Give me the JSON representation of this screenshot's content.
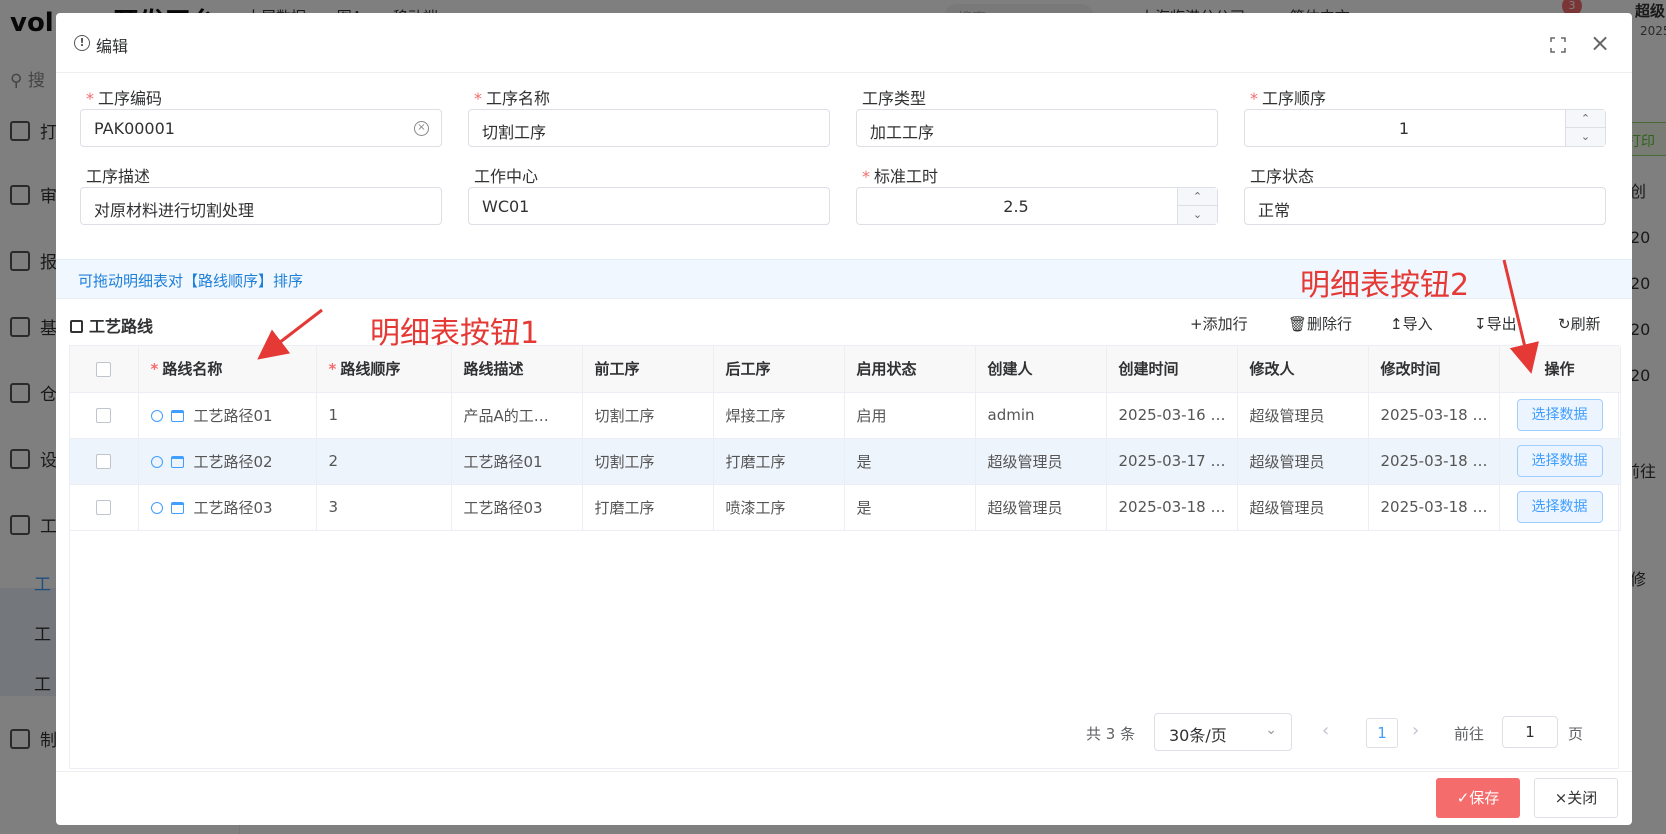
{
  "background": {
    "logo": "vol.pro开发平台",
    "top_nav": [
      "大屏数据",
      "图A",
      "移动端"
    ],
    "search_placeholder": "搜索",
    "company": "上海临港分公司",
    "language": "简体中文",
    "badge_count": "3",
    "user_name": "超级",
    "user_date": "2025",
    "sidebar_search": "搜",
    "sidebar_items": [
      "打",
      "审",
      "报",
      "基",
      "仓",
      "设",
      "工",
      "工",
      "工",
      "工",
      "制"
    ],
    "right_col": [
      "打印",
      "创",
      "20",
      "20",
      "20",
      "20",
      "前往",
      "修"
    ]
  },
  "dialog": {
    "title": "编辑",
    "fields": {
      "code": {
        "label": "工序编码",
        "value": "PAK00001",
        "required": true
      },
      "name": {
        "label": "工序名称",
        "value": "切割工序",
        "required": true
      },
      "type": {
        "label": "工序类型",
        "value": "加工工序",
        "required": false
      },
      "order": {
        "label": "工序顺序",
        "value": "1",
        "required": true
      },
      "desc": {
        "label": "工序描述",
        "value": "对原材料进行切割处理",
        "required": false
      },
      "center": {
        "label": "工作中心",
        "value": "WC01",
        "required": false
      },
      "std_time": {
        "label": "标准工时",
        "value": "2.5",
        "required": true
      },
      "status": {
        "label": "工序状态",
        "value": "正常",
        "required": false
      }
    },
    "tip": "可拖动明细表对【路线顺序】排序",
    "section_title": "工艺路线",
    "toolbar": {
      "add": "添加行",
      "delete": "删除行",
      "import": "导入",
      "export": "导出",
      "refresh": "刷新"
    },
    "table": {
      "columns": [
        "路线名称",
        "路线顺序",
        "路线描述",
        "前工序",
        "后工序",
        "启用状态",
        "创建人",
        "创建时间",
        "修改人",
        "修改时间",
        "操作"
      ],
      "required_columns": [
        "路线名称",
        "路线顺序"
      ],
      "rows": [
        {
          "name": "工艺路径01",
          "order": "1",
          "desc": "产品A的工…",
          "prev": "切割工序",
          "next": "焊接工序",
          "enabled": "启用",
          "creator": "admin",
          "created": "2025-03-16 …",
          "modifier": "超级管理员",
          "modified": "2025-03-18 …",
          "action": "选择数据"
        },
        {
          "name": "工艺路径02",
          "order": "2",
          "desc": "工艺路径01",
          "prev": "切割工序",
          "next": "打磨工序",
          "enabled": "是",
          "creator": "超级管理员",
          "created": "2025-03-17 …",
          "modifier": "超级管理员",
          "modified": "2025-03-18 …",
          "action": "选择数据"
        },
        {
          "name": "工艺路径03",
          "order": "3",
          "desc": "工艺路径03",
          "prev": "打磨工序",
          "next": "喷漆工序",
          "enabled": "是",
          "creator": "超级管理员",
          "created": "2025-03-18 …",
          "modifier": "超级管理员",
          "modified": "2025-03-18 …",
          "action": "选择数据"
        }
      ]
    },
    "pager": {
      "total": "共 3 条",
      "page_size": "30条/页",
      "current": "1",
      "goto_label": "前往",
      "goto_value": "1",
      "page_unit": "页"
    },
    "buttons": {
      "save": "保存",
      "close": "关闭"
    }
  },
  "annotations": {
    "label1": "明细表按钮1",
    "label2": "明细表按钮2"
  },
  "colors": {
    "primary": "#409eff",
    "danger": "#f56c6c",
    "annotation": "#e53935"
  }
}
